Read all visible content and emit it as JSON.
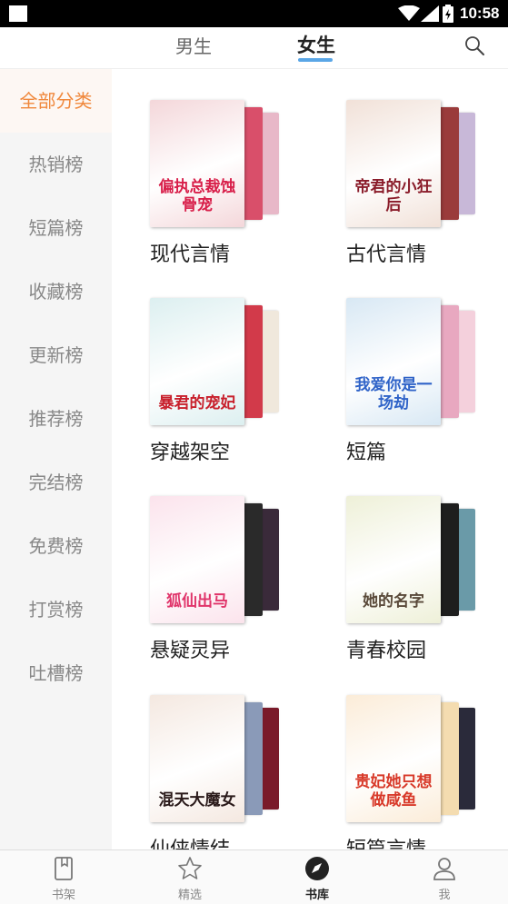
{
  "status_bar": {
    "time": "10:58"
  },
  "top_tabs": [
    {
      "label": "男生",
      "active": false
    },
    {
      "label": "女生",
      "active": true
    }
  ],
  "sidebar": {
    "items": [
      {
        "label": "全部分类",
        "active": true
      },
      {
        "label": "热销榜"
      },
      {
        "label": "短篇榜"
      },
      {
        "label": "收藏榜"
      },
      {
        "label": "更新榜"
      },
      {
        "label": "推荐榜"
      },
      {
        "label": "完结榜"
      },
      {
        "label": "免费榜"
      },
      {
        "label": "打赏榜"
      },
      {
        "label": "吐槽榜"
      }
    ]
  },
  "categories": [
    {
      "label": "现代言情",
      "cover_title": "偏执总裁蚀骨宠",
      "cover_colors": [
        "#f4d7da",
        "#d94f6a",
        "#e8b8c8"
      ],
      "title_color": "#d81f4a"
    },
    {
      "label": "古代言情",
      "cover_title": "帝君的小狂后",
      "cover_colors": [
        "#f1e1d8",
        "#9a3b3b",
        "#c8b8d8"
      ],
      "title_color": "#8a1c2a"
    },
    {
      "label": "穿越架空",
      "cover_title": "暴君的宠妃",
      "cover_colors": [
        "#dceff0",
        "#d23a4a",
        "#f0e8dc"
      ],
      "title_color": "#c8202c"
    },
    {
      "label": "短篇",
      "cover_title": "我爱你是一场劫",
      "cover_colors": [
        "#d8e8f4",
        "#e8a8c0",
        "#f4d0dc"
      ],
      "title_color": "#2f63c8"
    },
    {
      "label": "悬疑灵异",
      "cover_title": "狐仙出马",
      "cover_colors": [
        "#fbe3ec",
        "#2a2a2a",
        "#3a2a3a"
      ],
      "title_color": "#e0346a"
    },
    {
      "label": "青春校园",
      "cover_title": "她的名字",
      "cover_colors": [
        "#eef0d8",
        "#1e1e1e",
        "#6a9aa8"
      ],
      "title_color": "#5a4a3a"
    },
    {
      "label": "仙侠情结",
      "cover_title": "混天大魔女",
      "cover_colors": [
        "#f4e8e0",
        "#8a9ab8",
        "#7a1a2a"
      ],
      "title_color": "#2a1a1a"
    },
    {
      "label": "短篇言情",
      "cover_title": "贵妃她只想做咸鱼",
      "cover_colors": [
        "#fbecd8",
        "#f4dcb0",
        "#2a2a3a"
      ],
      "title_color": "#d83a2a"
    }
  ],
  "bottom_nav": [
    {
      "label": "书架",
      "icon": "bookshelf-icon",
      "active": false
    },
    {
      "label": "精选",
      "icon": "star-icon",
      "active": false
    },
    {
      "label": "书库",
      "icon": "compass-icon",
      "active": true
    },
    {
      "label": "我",
      "icon": "user-icon",
      "active": false
    }
  ],
  "colors": {
    "accent_orange": "#f0883c",
    "tab_underline": "#5aa6e6",
    "sidebar_bg": "#f5f5f5"
  }
}
